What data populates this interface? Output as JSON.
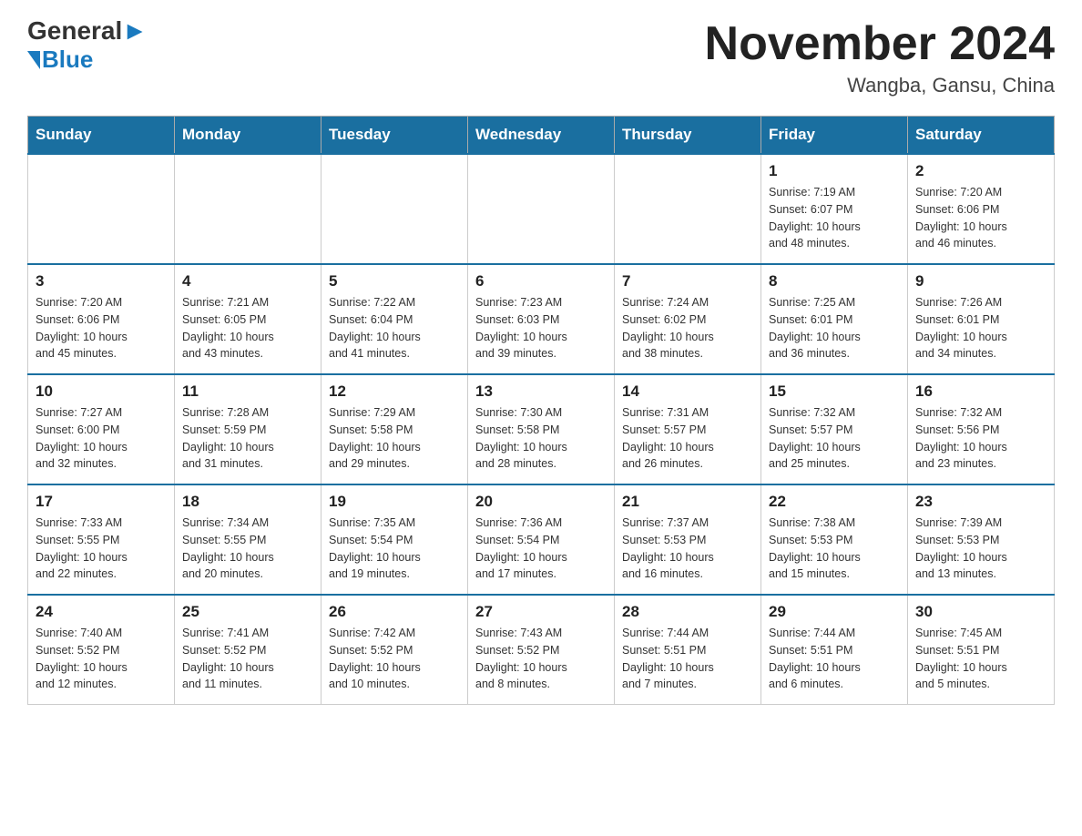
{
  "header": {
    "logo_general": "General",
    "logo_blue": "Blue",
    "month_year": "November 2024",
    "location": "Wangba, Gansu, China"
  },
  "weekdays": [
    "Sunday",
    "Monday",
    "Tuesday",
    "Wednesday",
    "Thursday",
    "Friday",
    "Saturday"
  ],
  "weeks": [
    {
      "days": [
        {
          "num": "",
          "info": ""
        },
        {
          "num": "",
          "info": ""
        },
        {
          "num": "",
          "info": ""
        },
        {
          "num": "",
          "info": ""
        },
        {
          "num": "",
          "info": ""
        },
        {
          "num": "1",
          "info": "Sunrise: 7:19 AM\nSunset: 6:07 PM\nDaylight: 10 hours\nand 48 minutes."
        },
        {
          "num": "2",
          "info": "Sunrise: 7:20 AM\nSunset: 6:06 PM\nDaylight: 10 hours\nand 46 minutes."
        }
      ]
    },
    {
      "days": [
        {
          "num": "3",
          "info": "Sunrise: 7:20 AM\nSunset: 6:06 PM\nDaylight: 10 hours\nand 45 minutes."
        },
        {
          "num": "4",
          "info": "Sunrise: 7:21 AM\nSunset: 6:05 PM\nDaylight: 10 hours\nand 43 minutes."
        },
        {
          "num": "5",
          "info": "Sunrise: 7:22 AM\nSunset: 6:04 PM\nDaylight: 10 hours\nand 41 minutes."
        },
        {
          "num": "6",
          "info": "Sunrise: 7:23 AM\nSunset: 6:03 PM\nDaylight: 10 hours\nand 39 minutes."
        },
        {
          "num": "7",
          "info": "Sunrise: 7:24 AM\nSunset: 6:02 PM\nDaylight: 10 hours\nand 38 minutes."
        },
        {
          "num": "8",
          "info": "Sunrise: 7:25 AM\nSunset: 6:01 PM\nDaylight: 10 hours\nand 36 minutes."
        },
        {
          "num": "9",
          "info": "Sunrise: 7:26 AM\nSunset: 6:01 PM\nDaylight: 10 hours\nand 34 minutes."
        }
      ]
    },
    {
      "days": [
        {
          "num": "10",
          "info": "Sunrise: 7:27 AM\nSunset: 6:00 PM\nDaylight: 10 hours\nand 32 minutes."
        },
        {
          "num": "11",
          "info": "Sunrise: 7:28 AM\nSunset: 5:59 PM\nDaylight: 10 hours\nand 31 minutes."
        },
        {
          "num": "12",
          "info": "Sunrise: 7:29 AM\nSunset: 5:58 PM\nDaylight: 10 hours\nand 29 minutes."
        },
        {
          "num": "13",
          "info": "Sunrise: 7:30 AM\nSunset: 5:58 PM\nDaylight: 10 hours\nand 28 minutes."
        },
        {
          "num": "14",
          "info": "Sunrise: 7:31 AM\nSunset: 5:57 PM\nDaylight: 10 hours\nand 26 minutes."
        },
        {
          "num": "15",
          "info": "Sunrise: 7:32 AM\nSunset: 5:57 PM\nDaylight: 10 hours\nand 25 minutes."
        },
        {
          "num": "16",
          "info": "Sunrise: 7:32 AM\nSunset: 5:56 PM\nDaylight: 10 hours\nand 23 minutes."
        }
      ]
    },
    {
      "days": [
        {
          "num": "17",
          "info": "Sunrise: 7:33 AM\nSunset: 5:55 PM\nDaylight: 10 hours\nand 22 minutes."
        },
        {
          "num": "18",
          "info": "Sunrise: 7:34 AM\nSunset: 5:55 PM\nDaylight: 10 hours\nand 20 minutes."
        },
        {
          "num": "19",
          "info": "Sunrise: 7:35 AM\nSunset: 5:54 PM\nDaylight: 10 hours\nand 19 minutes."
        },
        {
          "num": "20",
          "info": "Sunrise: 7:36 AM\nSunset: 5:54 PM\nDaylight: 10 hours\nand 17 minutes."
        },
        {
          "num": "21",
          "info": "Sunrise: 7:37 AM\nSunset: 5:53 PM\nDaylight: 10 hours\nand 16 minutes."
        },
        {
          "num": "22",
          "info": "Sunrise: 7:38 AM\nSunset: 5:53 PM\nDaylight: 10 hours\nand 15 minutes."
        },
        {
          "num": "23",
          "info": "Sunrise: 7:39 AM\nSunset: 5:53 PM\nDaylight: 10 hours\nand 13 minutes."
        }
      ]
    },
    {
      "days": [
        {
          "num": "24",
          "info": "Sunrise: 7:40 AM\nSunset: 5:52 PM\nDaylight: 10 hours\nand 12 minutes."
        },
        {
          "num": "25",
          "info": "Sunrise: 7:41 AM\nSunset: 5:52 PM\nDaylight: 10 hours\nand 11 minutes."
        },
        {
          "num": "26",
          "info": "Sunrise: 7:42 AM\nSunset: 5:52 PM\nDaylight: 10 hours\nand 10 minutes."
        },
        {
          "num": "27",
          "info": "Sunrise: 7:43 AM\nSunset: 5:52 PM\nDaylight: 10 hours\nand 8 minutes."
        },
        {
          "num": "28",
          "info": "Sunrise: 7:44 AM\nSunset: 5:51 PM\nDaylight: 10 hours\nand 7 minutes."
        },
        {
          "num": "29",
          "info": "Sunrise: 7:44 AM\nSunset: 5:51 PM\nDaylight: 10 hours\nand 6 minutes."
        },
        {
          "num": "30",
          "info": "Sunrise: 7:45 AM\nSunset: 5:51 PM\nDaylight: 10 hours\nand 5 minutes."
        }
      ]
    }
  ]
}
